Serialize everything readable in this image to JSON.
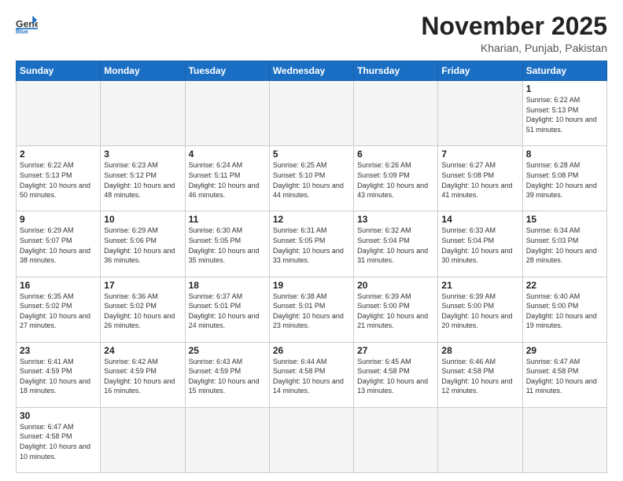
{
  "header": {
    "logo_general": "General",
    "logo_blue": "Blue",
    "month_title": "November 2025",
    "location": "Kharian, Punjab, Pakistan"
  },
  "weekdays": [
    "Sunday",
    "Monday",
    "Tuesday",
    "Wednesday",
    "Thursday",
    "Friday",
    "Saturday"
  ],
  "weeks": [
    [
      {
        "day": "",
        "empty": true
      },
      {
        "day": "",
        "empty": true
      },
      {
        "day": "",
        "empty": true
      },
      {
        "day": "",
        "empty": true
      },
      {
        "day": "",
        "empty": true
      },
      {
        "day": "",
        "empty": true
      },
      {
        "day": "1",
        "sunrise": "6:22 AM",
        "sunset": "5:13 PM",
        "daylight": "10 hours and 51 minutes."
      }
    ],
    [
      {
        "day": "2",
        "sunrise": "6:22 AM",
        "sunset": "5:13 PM",
        "daylight": "10 hours and 50 minutes."
      },
      {
        "day": "3",
        "sunrise": "6:23 AM",
        "sunset": "5:12 PM",
        "daylight": "10 hours and 48 minutes."
      },
      {
        "day": "4",
        "sunrise": "6:24 AM",
        "sunset": "5:11 PM",
        "daylight": "10 hours and 46 minutes."
      },
      {
        "day": "5",
        "sunrise": "6:25 AM",
        "sunset": "5:10 PM",
        "daylight": "10 hours and 44 minutes."
      },
      {
        "day": "6",
        "sunrise": "6:26 AM",
        "sunset": "5:09 PM",
        "daylight": "10 hours and 43 minutes."
      },
      {
        "day": "7",
        "sunrise": "6:27 AM",
        "sunset": "5:08 PM",
        "daylight": "10 hours and 41 minutes."
      },
      {
        "day": "8",
        "sunrise": "6:28 AM",
        "sunset": "5:08 PM",
        "daylight": "10 hours and 39 minutes."
      }
    ],
    [
      {
        "day": "9",
        "sunrise": "6:29 AM",
        "sunset": "5:07 PM",
        "daylight": "10 hours and 38 minutes."
      },
      {
        "day": "10",
        "sunrise": "6:29 AM",
        "sunset": "5:06 PM",
        "daylight": "10 hours and 36 minutes."
      },
      {
        "day": "11",
        "sunrise": "6:30 AM",
        "sunset": "5:05 PM",
        "daylight": "10 hours and 35 minutes."
      },
      {
        "day": "12",
        "sunrise": "6:31 AM",
        "sunset": "5:05 PM",
        "daylight": "10 hours and 33 minutes."
      },
      {
        "day": "13",
        "sunrise": "6:32 AM",
        "sunset": "5:04 PM",
        "daylight": "10 hours and 31 minutes."
      },
      {
        "day": "14",
        "sunrise": "6:33 AM",
        "sunset": "5:04 PM",
        "daylight": "10 hours and 30 minutes."
      },
      {
        "day": "15",
        "sunrise": "6:34 AM",
        "sunset": "5:03 PM",
        "daylight": "10 hours and 28 minutes."
      }
    ],
    [
      {
        "day": "16",
        "sunrise": "6:35 AM",
        "sunset": "5:02 PM",
        "daylight": "10 hours and 27 minutes."
      },
      {
        "day": "17",
        "sunrise": "6:36 AM",
        "sunset": "5:02 PM",
        "daylight": "10 hours and 26 minutes."
      },
      {
        "day": "18",
        "sunrise": "6:37 AM",
        "sunset": "5:01 PM",
        "daylight": "10 hours and 24 minutes."
      },
      {
        "day": "19",
        "sunrise": "6:38 AM",
        "sunset": "5:01 PM",
        "daylight": "10 hours and 23 minutes."
      },
      {
        "day": "20",
        "sunrise": "6:39 AM",
        "sunset": "5:00 PM",
        "daylight": "10 hours and 21 minutes."
      },
      {
        "day": "21",
        "sunrise": "6:39 AM",
        "sunset": "5:00 PM",
        "daylight": "10 hours and 20 minutes."
      },
      {
        "day": "22",
        "sunrise": "6:40 AM",
        "sunset": "5:00 PM",
        "daylight": "10 hours and 19 minutes."
      }
    ],
    [
      {
        "day": "23",
        "sunrise": "6:41 AM",
        "sunset": "4:59 PM",
        "daylight": "10 hours and 18 minutes."
      },
      {
        "day": "24",
        "sunrise": "6:42 AM",
        "sunset": "4:59 PM",
        "daylight": "10 hours and 16 minutes."
      },
      {
        "day": "25",
        "sunrise": "6:43 AM",
        "sunset": "4:59 PM",
        "daylight": "10 hours and 15 minutes."
      },
      {
        "day": "26",
        "sunrise": "6:44 AM",
        "sunset": "4:58 PM",
        "daylight": "10 hours and 14 minutes."
      },
      {
        "day": "27",
        "sunrise": "6:45 AM",
        "sunset": "4:58 PM",
        "daylight": "10 hours and 13 minutes."
      },
      {
        "day": "28",
        "sunrise": "6:46 AM",
        "sunset": "4:58 PM",
        "daylight": "10 hours and 12 minutes."
      },
      {
        "day": "29",
        "sunrise": "6:47 AM",
        "sunset": "4:58 PM",
        "daylight": "10 hours and 11 minutes."
      }
    ],
    [
      {
        "day": "30",
        "sunrise": "6:47 AM",
        "sunset": "4:58 PM",
        "daylight": "10 hours and 10 minutes."
      },
      {
        "day": "",
        "empty": true
      },
      {
        "day": "",
        "empty": true
      },
      {
        "day": "",
        "empty": true
      },
      {
        "day": "",
        "empty": true
      },
      {
        "day": "",
        "empty": true
      },
      {
        "day": "",
        "empty": true
      }
    ]
  ]
}
